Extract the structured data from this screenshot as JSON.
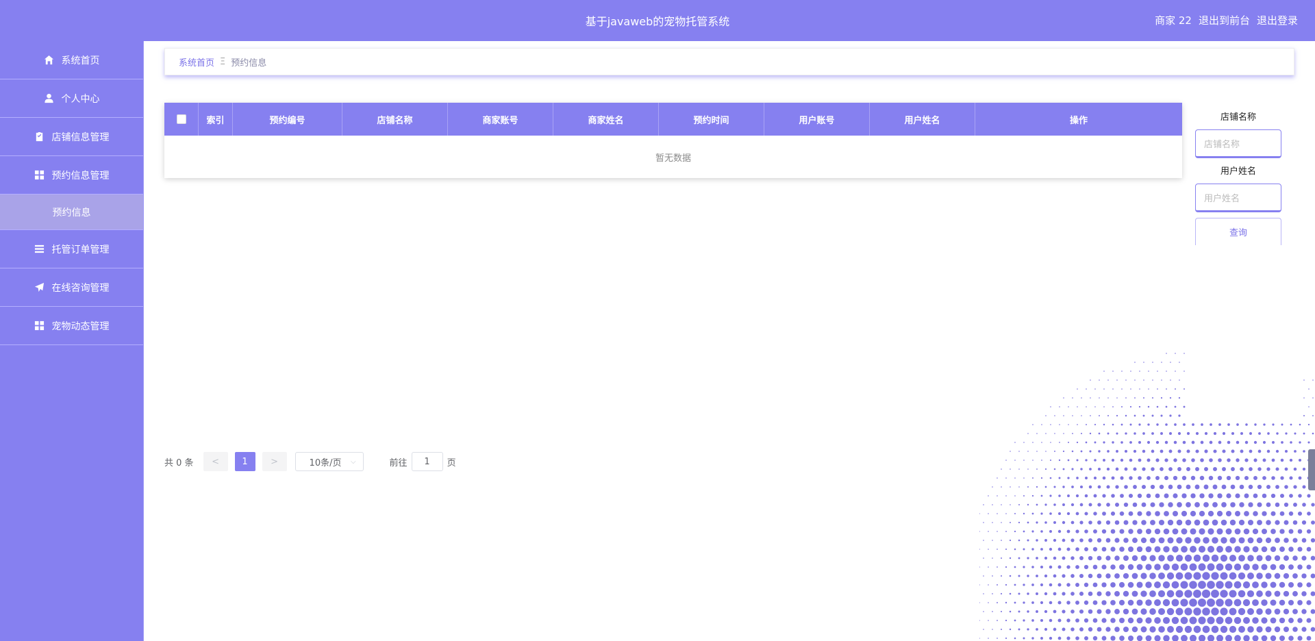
{
  "header": {
    "title": "基于javaweb的宠物托管系统",
    "user_label": "商家 22",
    "back_to_front": "退出到前台",
    "logout": "退出登录"
  },
  "sidebar": {
    "items": [
      {
        "label": "系统首页",
        "icon": "home-icon"
      },
      {
        "label": "个人中心",
        "icon": "user-icon"
      },
      {
        "label": "店铺信息管理",
        "icon": "clipboard-icon"
      },
      {
        "label": "预约信息管理",
        "icon": "grid-icon"
      },
      {
        "label": "预约信息",
        "icon": ""
      },
      {
        "label": "托管订单管理",
        "icon": "list-icon"
      },
      {
        "label": "在线咨询管理",
        "icon": "send-icon"
      },
      {
        "label": "宠物动态管理",
        "icon": "grid-icon"
      }
    ]
  },
  "breadcrumb": {
    "home": "系统首页",
    "separator": "Ξ",
    "current": "预约信息"
  },
  "table": {
    "columns": [
      "索引",
      "预约编号",
      "店铺名称",
      "商家账号",
      "商家姓名",
      "预约时间",
      "用户账号",
      "用户姓名",
      "操作"
    ],
    "empty_text": "暂无数据"
  },
  "search": {
    "shop_label": "店铺名称",
    "shop_placeholder": "店铺名称",
    "user_label": "用户姓名",
    "user_placeholder": "用户姓名",
    "query_button": "查询"
  },
  "pagination": {
    "total": "共 0 条",
    "prev": "<",
    "current_page": "1",
    "next": ">",
    "page_size": "10条/页",
    "goto_prefix": "前往",
    "goto_value": "1",
    "goto_suffix": "页"
  },
  "colors": {
    "primary": "#8680f0",
    "submenu_active": "#a9a3e8"
  }
}
